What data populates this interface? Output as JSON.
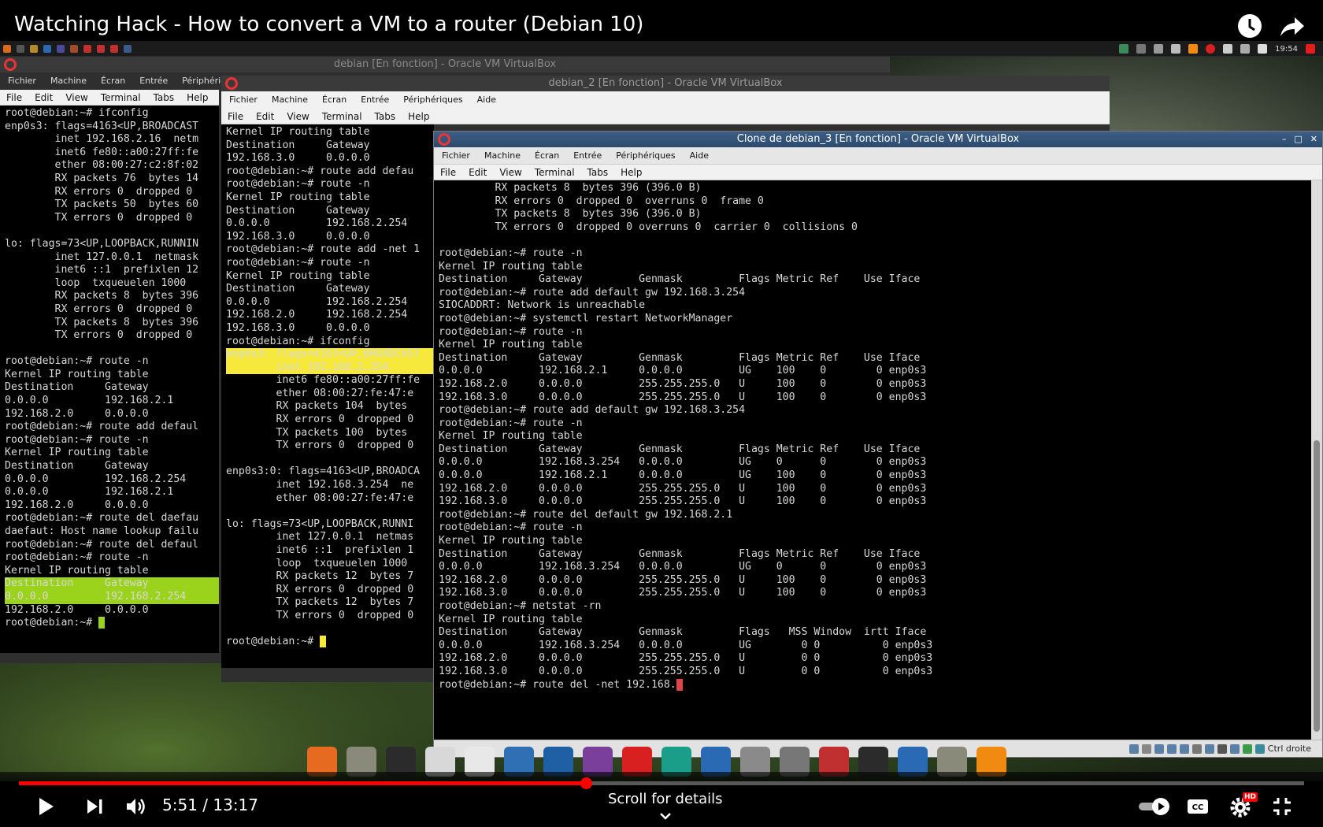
{
  "video": {
    "title": "Watching Hack - How to convert a VM to a router (Debian 10)",
    "time": "5:51 / 13:17",
    "progress_fraction": 0.441,
    "scroll_hint": "Scroll for details",
    "hd_badge": "HD"
  },
  "host_panel": {
    "clock": "19:54"
  },
  "windows": [
    {
      "title": "debian [En fonction] - Oracle VM VirtualBox",
      "vbox_menu": [
        "Fichier",
        "Machine",
        "Écran",
        "Entrée",
        "Périphériques"
      ],
      "term_menu": [
        "File",
        "Edit",
        "View",
        "Terminal",
        "Tabs",
        "Help"
      ],
      "text_a": "root@debian:~# ifconfig\nenp0s3: flags=4163<UP,BROADCAST\n        inet 192.168.2.16  netm\n        inet6 fe80::a00:27ff:fe\n        ether 08:00:27:c2:8f:02\n        RX packets 76  bytes 14\n        RX errors 0  dropped 0\n        TX packets 50  bytes 60\n        TX errors 0  dropped 0\n\nlo: flags=73<UP,LOOPBACK,RUNNIN\n        inet 127.0.0.1  netmask\n        inet6 ::1  prefixlen 12\n        loop  txqueuelen 1000\n        RX packets 8  bytes 396\n        RX errors 0  dropped 0\n        TX packets 8  bytes 396\n        TX errors 0  dropped 0\n\nroot@debian:~# route -n\nKernel IP routing table\nDestination     Gateway\n0.0.0.0         192.168.2.1\n192.168.2.0     0.0.0.0\nroot@debian:~# route add defaul\nroot@debian:~# route -n\nKernel IP routing table\nDestination     Gateway\n0.0.0.0         192.168.2.254\n0.0.0.0         192.168.2.1\n192.168.2.0     0.0.0.0\nroot@debian:~# route del daefau\ndaefaut: Host name lookup failu\nroot@debian:~# route del defaul\nroot@debian:~# route -n\nKernel IP routing table",
      "text_hl": "Destination     Gateway         \n0.0.0.0         192.168.2.254   ",
      "text_b": "192.168.2.0     0.0.0.0\nroot@debian:~# "
    },
    {
      "title": "debian_2 [En fonction] - Oracle VM VirtualBox",
      "vbox_menu": [
        "Fichier",
        "Machine",
        "Écran",
        "Entrée",
        "Périphériques",
        "Aide"
      ],
      "term_menu": [
        "File",
        "Edit",
        "View",
        "Terminal",
        "Tabs",
        "Help"
      ],
      "text_a": "Kernel IP routing table\nDestination     Gateway\n192.168.3.0     0.0.0.0\nroot@debian:~# route add defau\nroot@debian:~# route -n\nKernel IP routing table\nDestination     Gateway\n0.0.0.0         192.168.2.254\n192.168.3.0     0.0.0.0\nroot@debian:~# route add -net 1\nroot@debian:~# route -n\nKernel IP routing table\nDestination     Gateway\n0.0.0.0         192.168.2.254\n192.168.2.0     192.168.2.254\n192.168.3.0     0.0.0.0\nroot@debian:~# ifconfig",
      "text_hl": "enp0s3: flags=4163<UP,BROADCAST\n        inet 192.168.2.254 ",
      "text_b": "        inet6 fe80::a00:27ff:fe\n        ether 08:00:27:fe:47:e\n        RX packets 104  bytes \n        RX errors 0  dropped 0\n        TX packets 100  bytes \n        TX errors 0  dropped 0\n\nenp0s3:0: flags=4163<UP,BROADCA\n        inet 192.168.3.254  ne\n        ether 08:00:27:fe:47:e\n\nlo: flags=73<UP,LOOPBACK,RUNNI\n        inet 127.0.0.1  netmas\n        inet6 ::1  prefixlen 1\n        loop  txqueuelen 1000\n        RX packets 12  bytes 7\n        RX errors 0  dropped 0\n        TX packets 12  bytes 7\n        TX errors 0  dropped 0\n\nroot@debian:~# "
    },
    {
      "title": "Clone de debian_3 [En fonction] - Oracle VM VirtualBox",
      "vbox_menu": [
        "Fichier",
        "Machine",
        "Écran",
        "Entrée",
        "Périphériques",
        "Aide"
      ],
      "term_menu": [
        "File",
        "Edit",
        "View",
        "Terminal",
        "Tabs",
        "Help"
      ],
      "text": "         RX packets 8  bytes 396 (396.0 B)\n         RX errors 0  dropped 0  overruns 0  frame 0\n         TX packets 8  bytes 396 (396.0 B)\n         TX errors 0  dropped 0 overruns 0  carrier 0  collisions 0\n\nroot@debian:~# route -n\nKernel IP routing table\nDestination     Gateway         Genmask         Flags Metric Ref    Use Iface\nroot@debian:~# route add default gw 192.168.3.254\nSIOCADDRT: Network is unreachable\nroot@debian:~# systemctl restart NetworkManager\nroot@debian:~# route -n\nKernel IP routing table\nDestination     Gateway         Genmask         Flags Metric Ref    Use Iface\n0.0.0.0         192.168.2.1     0.0.0.0         UG    100    0        0 enp0s3\n192.168.2.0     0.0.0.0         255.255.255.0   U     100    0        0 enp0s3\n192.168.3.0     0.0.0.0         255.255.255.0   U     100    0        0 enp0s3\nroot@debian:~# route add default gw 192.168.3.254\nroot@debian:~# route -n\nKernel IP routing table\nDestination     Gateway         Genmask         Flags Metric Ref    Use Iface\n0.0.0.0         192.168.3.254   0.0.0.0         UG    0      0        0 enp0s3\n0.0.0.0         192.168.2.1     0.0.0.0         UG    100    0        0 enp0s3\n192.168.2.0     0.0.0.0         255.255.255.0   U     100    0        0 enp0s3\n192.168.3.0     0.0.0.0         255.255.255.0   U     100    0        0 enp0s3\nroot@debian:~# route del default gw 192.168.2.1\nroot@debian:~# route -n\nKernel IP routing table\nDestination     Gateway         Genmask         Flags Metric Ref    Use Iface\n0.0.0.0         192.168.3.254   0.0.0.0         UG    0      0        0 enp0s3\n192.168.2.0     0.0.0.0         255.255.255.0   U     100    0        0 enp0s3\n192.168.3.0     0.0.0.0         255.255.255.0   U     100    0        0 enp0s3\nroot@debian:~# netstat -rn\nKernel IP routing table\nDestination     Gateway         Genmask         Flags   MSS Window  irtt Iface\n0.0.0.0         192.168.3.254   0.0.0.0         UG        0 0          0 enp0s3\n192.168.2.0     0.0.0.0         255.255.255.0   U         0 0          0 enp0s3\n192.168.3.0     0.0.0.0         255.255.255.0   U         0 0          0 enp0s3\nroot@debian:~# route del -net 192.168.",
      "status_key": "Ctrl droite"
    }
  ],
  "dock": [
    {
      "name": "firefox-icon",
      "color": "#e66a1f"
    },
    {
      "name": "files-icon",
      "color": "#8a8a7a"
    },
    {
      "name": "terminal-icon",
      "color": "#2b2b2b"
    },
    {
      "name": "text-editor-icon",
      "color": "#d8d8d8"
    },
    {
      "name": "document-icon",
      "color": "#e8e8e8"
    },
    {
      "name": "screen-icon",
      "color": "#2f6fb3"
    },
    {
      "name": "system-monitor-icon",
      "color": "#1f5fa3"
    },
    {
      "name": "music-icon",
      "color": "#7a3f9a"
    },
    {
      "name": "youtube-icon",
      "color": "#d92020"
    },
    {
      "name": "aperture-icon",
      "color": "#1a9e8a"
    },
    {
      "name": "network-icon",
      "color": "#2a6ab5"
    },
    {
      "name": "package-icon",
      "color": "#8a8a8a"
    },
    {
      "name": "trash-icon",
      "color": "#777777"
    },
    {
      "name": "virtualbox-icon",
      "color": "#c03030"
    },
    {
      "name": "terminal-2-icon",
      "color": "#2b2b2b"
    },
    {
      "name": "settings-icon",
      "color": "#2a6ab5"
    },
    {
      "name": "files-2-icon",
      "color": "#8a8a7a"
    },
    {
      "name": "vlc-icon",
      "color": "#f08a10"
    }
  ]
}
